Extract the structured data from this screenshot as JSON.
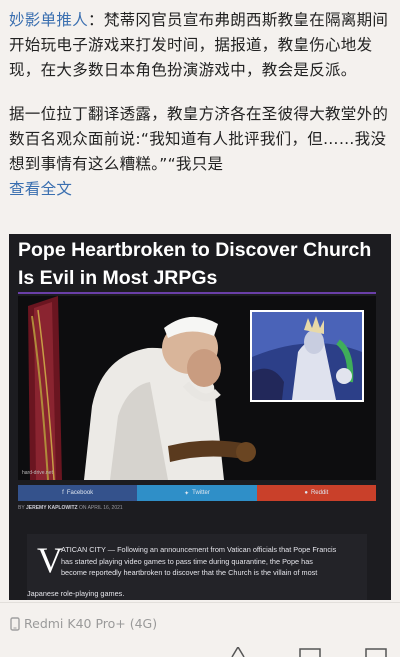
{
  "post": {
    "author": "妙影单推人",
    "separator": "：",
    "paragraph1": "梵蒂冈官员宣布弗朗西斯教皇在隔离期间开始玩电子游戏来打发时间，据报道，教皇伤心地发现，在大多数日本角色扮演游戏中，教会是反派。",
    "paragraph2": "据一位拉丁翻译透露，教皇方济各在圣彼得大教堂外的数百名观众面前说:“我知道有人批评我们，但……我没想到事情有这么糟糕。”“我只是",
    "see_all": "查看全文"
  },
  "article": {
    "headline": "Pope Heartbroken to Discover Church Is Evil in Most JRPGs",
    "photo_credit": "hard-drive.net",
    "share": [
      {
        "label": "Facebook",
        "icon": "facebook-icon",
        "color": "#34528c"
      },
      {
        "label": "Twitter",
        "icon": "twitter-icon",
        "color": "#2f8fc8"
      },
      {
        "label": "Reddit",
        "icon": "reddit-icon",
        "color": "#c9402a"
      }
    ],
    "byline_prefix": "BY",
    "author": "JEREMY KAPLOWITZ",
    "date": "ON APRIL 16, 2021",
    "dropcap": "V",
    "body_line1": "ATICAN CITY — Following an announcement from Vatican officials that Pope Francis",
    "body_line2": "has started playing video games to pass time during quarantine, the Pope has",
    "body_line3": "become reportedly heartbroken to discover that the Church is the villain of most",
    "body_line4": "Japanese role-playing games."
  },
  "device": {
    "icon": "phone-icon",
    "label": "Redmi K40 Pro+ (4G)"
  }
}
